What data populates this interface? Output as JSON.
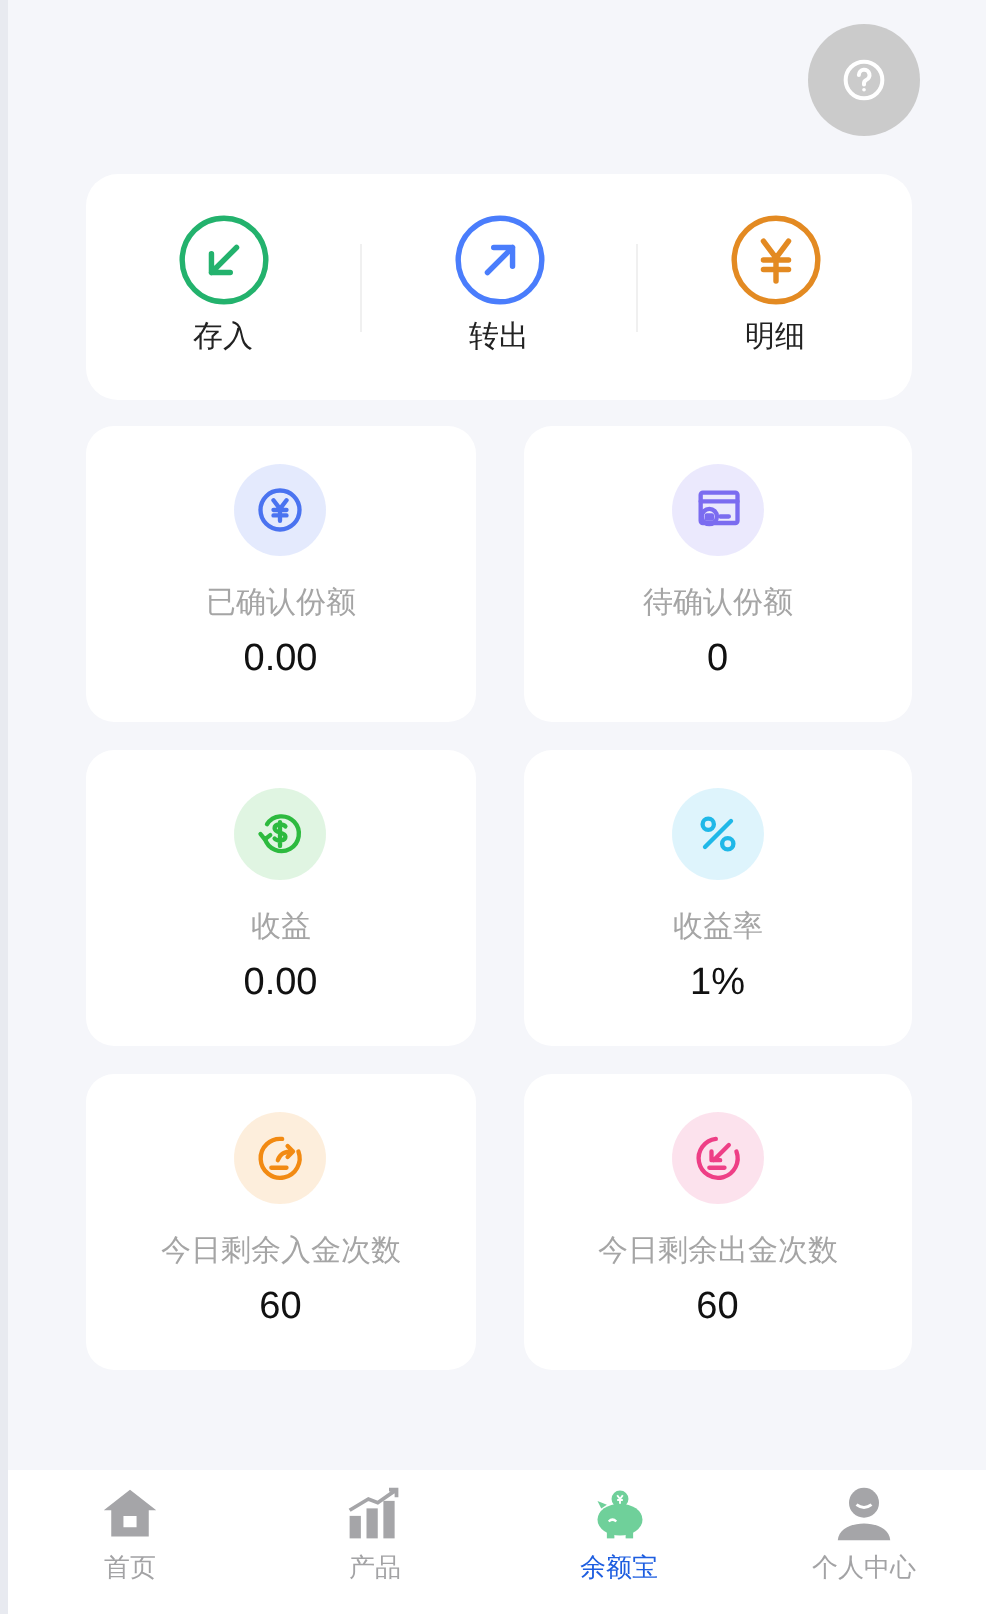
{
  "actions": [
    {
      "label": "存入",
      "kind": "deposit",
      "color": "#23b26d"
    },
    {
      "label": "转出",
      "kind": "transfer",
      "color": "#4a7dfc"
    },
    {
      "label": "明细",
      "kind": "yen",
      "color": "#e38a22"
    }
  ],
  "stats": [
    {
      "label": "已确认份额",
      "value": "0.00",
      "kind": "coin",
      "color": "#4a73f0"
    },
    {
      "label": "待确认份额",
      "value": "0",
      "kind": "card",
      "color": "#7b6cf0"
    },
    {
      "label": "收益",
      "value": "0.00",
      "kind": "income",
      "color": "#2dba3f"
    },
    {
      "label": "收益率",
      "value": "1%",
      "kind": "rate",
      "color": "#1fb8e8"
    },
    {
      "label": "今日剩余入金次数",
      "value": "60",
      "kind": "in",
      "color": "#f28a12"
    },
    {
      "label": "今日剩余出金次数",
      "value": "60",
      "kind": "out",
      "color": "#ee3f86"
    }
  ],
  "nav": [
    {
      "label": "首页",
      "kind": "home",
      "selected": false
    },
    {
      "label": "产品",
      "kind": "chart",
      "selected": false
    },
    {
      "label": "余额宝",
      "kind": "piggy",
      "selected": true
    },
    {
      "label": "个人中心",
      "kind": "person",
      "selected": false
    }
  ]
}
